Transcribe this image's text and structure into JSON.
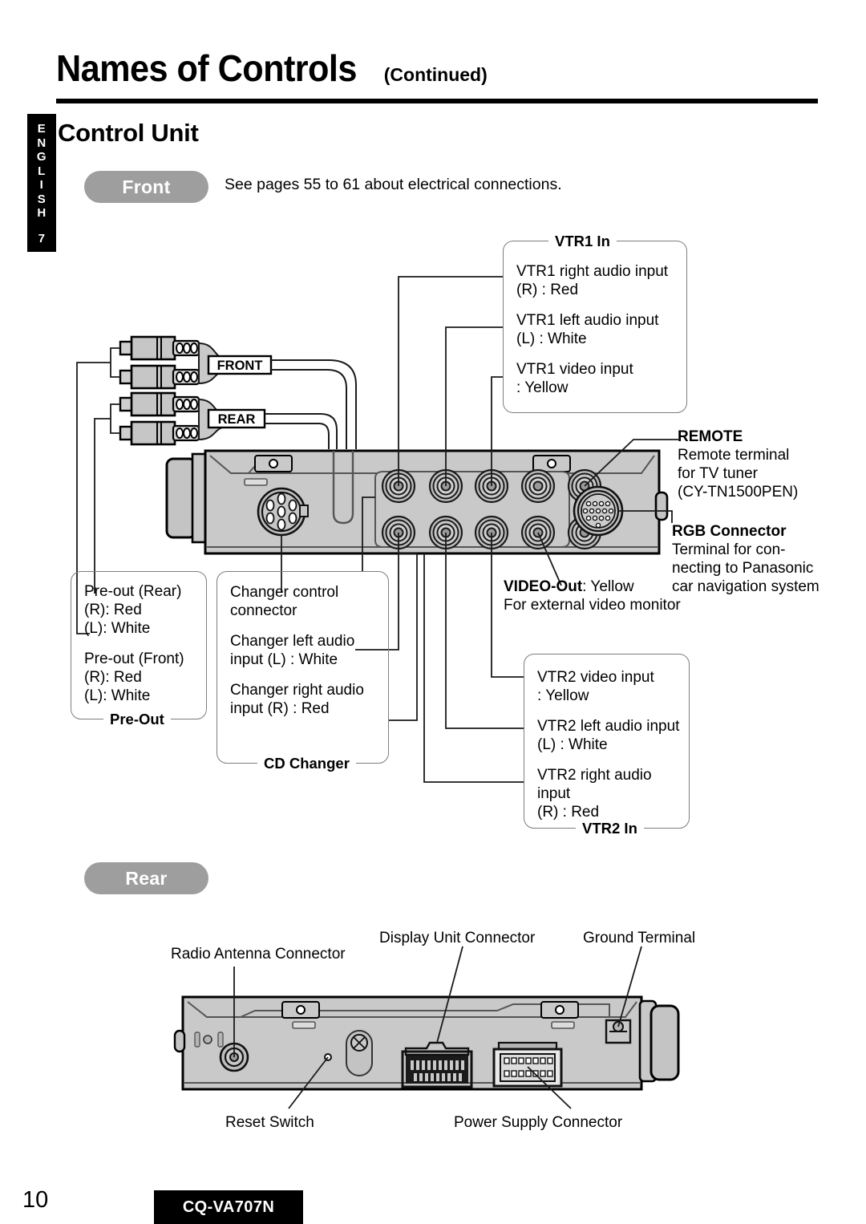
{
  "page": {
    "number": "10",
    "model_badge": "CQ-VA707N",
    "language_tab": {
      "letters": [
        "E",
        "N",
        "G",
        "L",
        "I",
        "S",
        "H"
      ],
      "number": "7"
    }
  },
  "header": {
    "title": "Names of Controls",
    "title_suffix": "(Continued)",
    "subtitle": "Control Unit"
  },
  "sections": {
    "front": {
      "pill_label": "Front",
      "note": "See pages 55 to 61 about electrical connections."
    },
    "rear": {
      "pill_label": "Rear"
    }
  },
  "callouts": {
    "vtr1_in": {
      "title": "VTR1 In",
      "title_position": "top",
      "lines": [
        "VTR1 right audio input\n(R) : Red",
        "VTR1 left audio input\n(L) : White",
        "VTR1 video input\n: Yellow"
      ]
    },
    "vtr2_in": {
      "title": "VTR2 In",
      "title_position": "bottom",
      "lines": [
        "VTR2 video input\n: Yellow",
        "VTR2 left audio input\n(L) : White",
        "VTR2 right audio input\n(R) : Red"
      ]
    },
    "pre_out": {
      "title": "Pre-Out",
      "title_position": "bottom",
      "lines": [
        "Pre-out (Rear)\n(R): Red\n(L):  White",
        "Pre-out (Front)\n(R): Red\n(L):  White"
      ]
    },
    "cd_changer": {
      "title": "CD Changer",
      "title_position": "bottom",
      "lines": [
        "Changer control\nconnector",
        "Changer left audio\ninput (L) : White",
        "Changer right audio\ninput (R) : Red"
      ]
    }
  },
  "labels": {
    "remote": {
      "heading": "REMOTE",
      "body": "Remote terminal\nfor TV tuner\n(CY-TN1500PEN)"
    },
    "rgb_connector": {
      "heading": "RGB Connector",
      "body": "Terminal for con-\nnecting to Panasonic\ncar navigation system"
    },
    "video_out": {
      "heading": "VIDEO-Out",
      "value": ": Yellow",
      "body": "For external video monitor"
    }
  },
  "rear_labels": {
    "radio_antenna": "Radio Antenna Connector",
    "display_unit": "Display Unit Connector",
    "ground_terminal": "Ground Terminal",
    "reset_switch": "Reset Switch",
    "power_supply": "Power Supply Connector"
  },
  "diagram": {
    "cable_tags": [
      "FRONT",
      "REAR"
    ],
    "front_jack_rows": 2,
    "front_jacks_per_row": 5
  },
  "colors": {
    "pill": "#9e9e9e",
    "chassis": "#c9c9c9",
    "chassis_dark": "#b0b0b0",
    "outline": "#000000",
    "callout_border": "#7d7d7d"
  }
}
